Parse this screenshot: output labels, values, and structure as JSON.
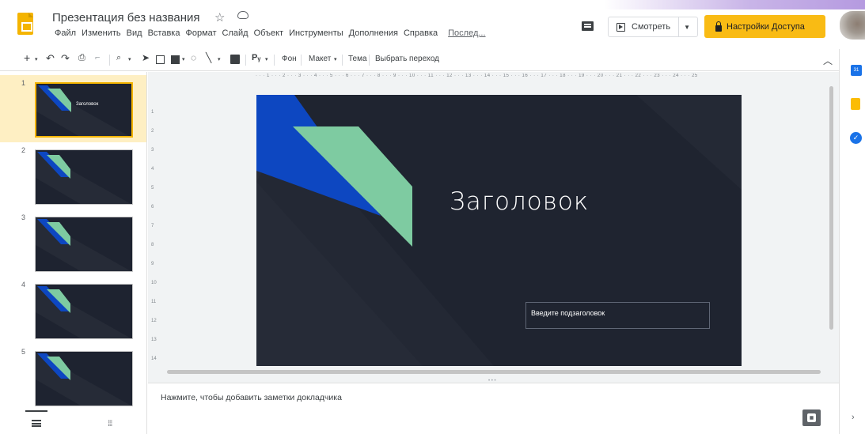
{
  "app": {
    "title": "Презентация без названия",
    "star_icon": "star-icon",
    "cloud_icon": "cloud-status-icon"
  },
  "menu": [
    "Файл",
    "Изменить",
    "Вид",
    "Вставка",
    "Формат",
    "Слайд",
    "Объект",
    "Инструменты",
    "Дополнения",
    "Справка"
  ],
  "last_edit_label": "Послед...",
  "header": {
    "present_label": "Смотреть",
    "share_label": "Настройки Доступа",
    "share_color": "#f9bb14"
  },
  "toolbar": {
    "background_label": "Фон",
    "layout_label": "Макет",
    "theme_label": "Тема",
    "transition_label": "Выбрать переход"
  },
  "ruler_ticks": "· · · 1 · · · 2 · · · 3 · · · 4 · · · 5 · · · 6 · · · 7 · · · 8 · · · 9 · · · 10 · · · 11 · · · 12 · · · 13 · · · 14 · · · 15 · · · 16 · · · 17 · · · 18 · · · 19 · · · 20 · · · 21 · · · 22 · · · 23 · · · 24 · · · 25",
  "vruler_ticks": [
    "1",
    "2",
    "3",
    "4",
    "5",
    "6",
    "7",
    "8",
    "9",
    "10",
    "11",
    "12",
    "13",
    "14"
  ],
  "slides": [
    {
      "number": "1",
      "title": "Заголовок",
      "selected": true
    },
    {
      "number": "2",
      "title": "",
      "selected": false
    },
    {
      "number": "3",
      "title": "",
      "selected": false
    },
    {
      "number": "4",
      "title": "",
      "selected": false
    },
    {
      "number": "5",
      "title": "",
      "selected": false
    }
  ],
  "current_slide": {
    "title": "Заголовок",
    "subtitle_placeholder": "Введите подзаголовок",
    "background_color": "#1f2430",
    "accent_blue": "#0d47c1",
    "accent_green": "#7ecba1"
  },
  "notes_placeholder": "Нажмите, чтобы добавить заметки докладчика"
}
